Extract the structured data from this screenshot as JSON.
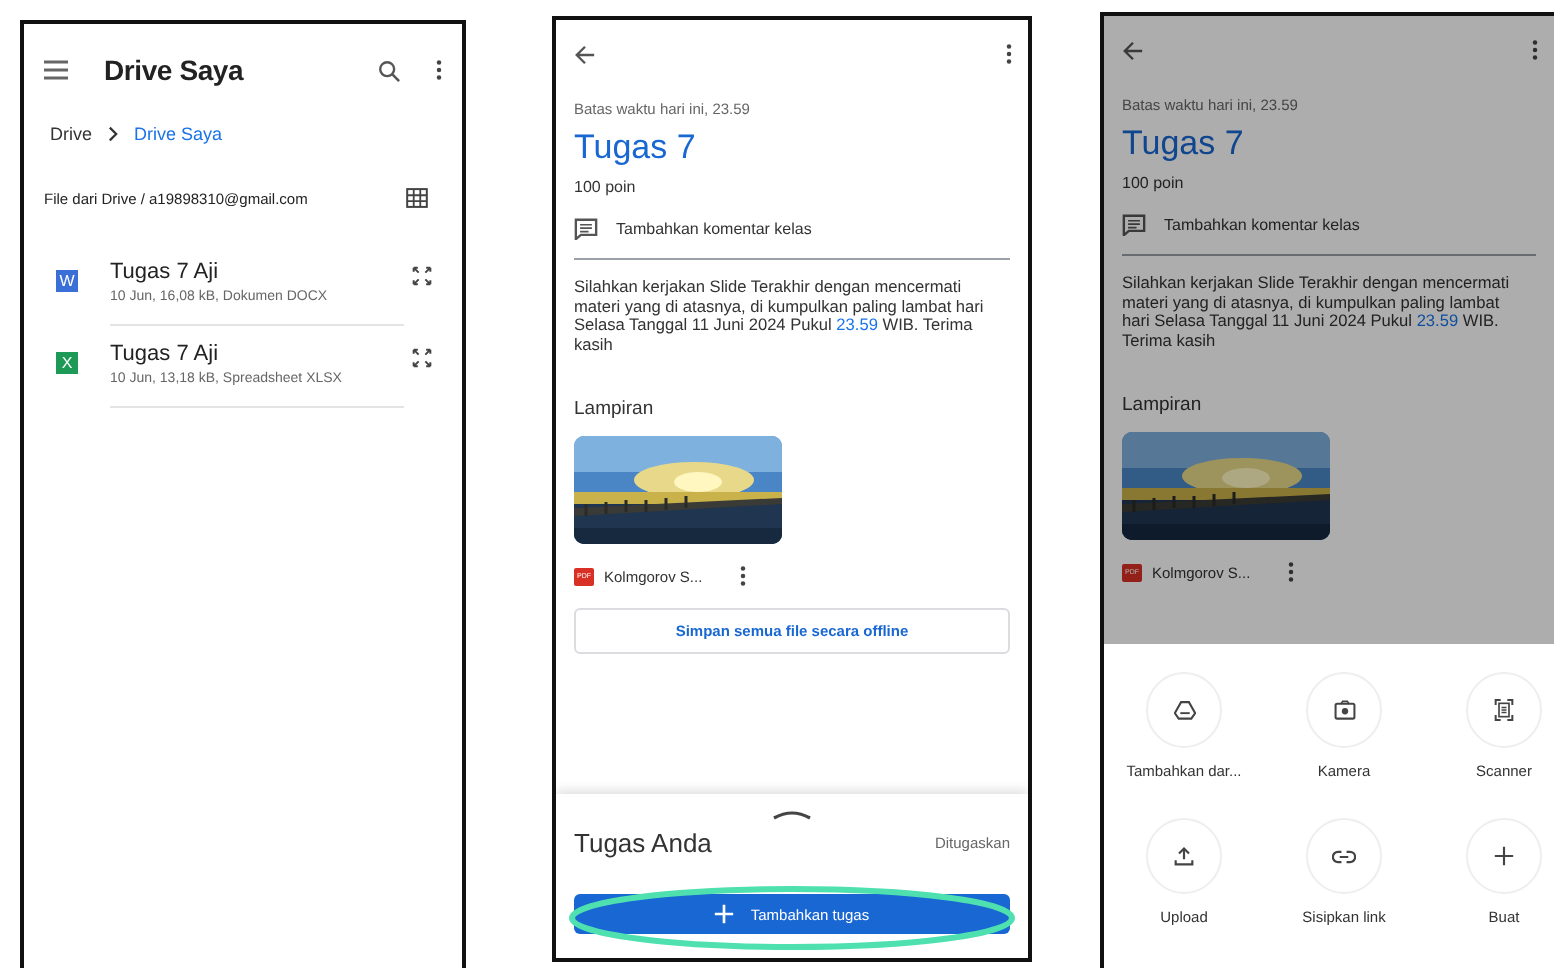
{
  "drive_screen": {
    "title": "Drive Saya",
    "breadcrumb": [
      {
        "label": "Drive",
        "selected": false
      },
      {
        "label": "Drive Saya",
        "selected": true
      }
    ],
    "location": "File dari Drive / a19898310@gmail.com",
    "files": [
      {
        "name": "Tugas 7 Aji",
        "details": "10 Jun, 16,08 kB, Dokumen DOCX",
        "kind": "docx",
        "badge": "W"
      },
      {
        "name": "Tugas 7 Aji",
        "details": "10 Jun, 13,18 kB, Spreadsheet XLSX",
        "kind": "xlsx",
        "badge": "X"
      }
    ]
  },
  "assignment_screen": {
    "deadline": "Batas waktu hari ini, 23.59",
    "title": "Tugas 7",
    "points": "100 poin",
    "comment": "Tambahkan komentar kelas",
    "instructions": [
      {
        "text": "Silahkan kerjakan Slide Terakhir dengan mencermati materi yang di atasnya, di kumpulkan paling lambat hari Selasa Tanggal 11 Juni 2024 Pukul ",
        "kind": "plain"
      },
      {
        "text": "23.59",
        "kind": "link"
      },
      {
        "text": " WIB. Terima kasih",
        "kind": "plain"
      }
    ],
    "attachments_heading": "Lampiran",
    "attachment": {
      "name": "Kolmgorov S...",
      "badge": "PDF"
    },
    "save_offline": "Simpan semua file secara offline",
    "submission": {
      "title": "Tugas Anda",
      "status": "Ditugaskan",
      "button": "Tambahkan tugas",
      "highlighted": true
    }
  },
  "attach_screen": {
    "deadline": "Batas waktu hari ini, 23.59",
    "title": "Tugas 7",
    "points": "100 poin",
    "comment": "Tambahkan komentar kelas",
    "instructions": [
      {
        "text": "Silahkan kerjakan Slide Terakhir dengan mencermati materi yang di atasnya, di kumpulkan paling lambat hari Selasa Tanggal 11 Juni 2024 Pukul ",
        "kind": "plain"
      },
      {
        "text": "23.59",
        "kind": "link"
      },
      {
        "text": " WIB. Terima kasih",
        "kind": "plain"
      }
    ],
    "attachments_heading": "Lampiran",
    "attachment": {
      "name": "Kolmgorov S...",
      "badge": "PDF"
    },
    "options": [
      {
        "label": "Tambahkan dar...",
        "kind": "drive"
      },
      {
        "label": "Kamera",
        "kind": "camera"
      },
      {
        "label": "Scanner",
        "kind": "scanner"
      },
      {
        "label": "Upload",
        "kind": "upload"
      },
      {
        "label": "Sisipkan link",
        "kind": "link"
      },
      {
        "label": "Buat",
        "kind": "create"
      }
    ]
  }
}
